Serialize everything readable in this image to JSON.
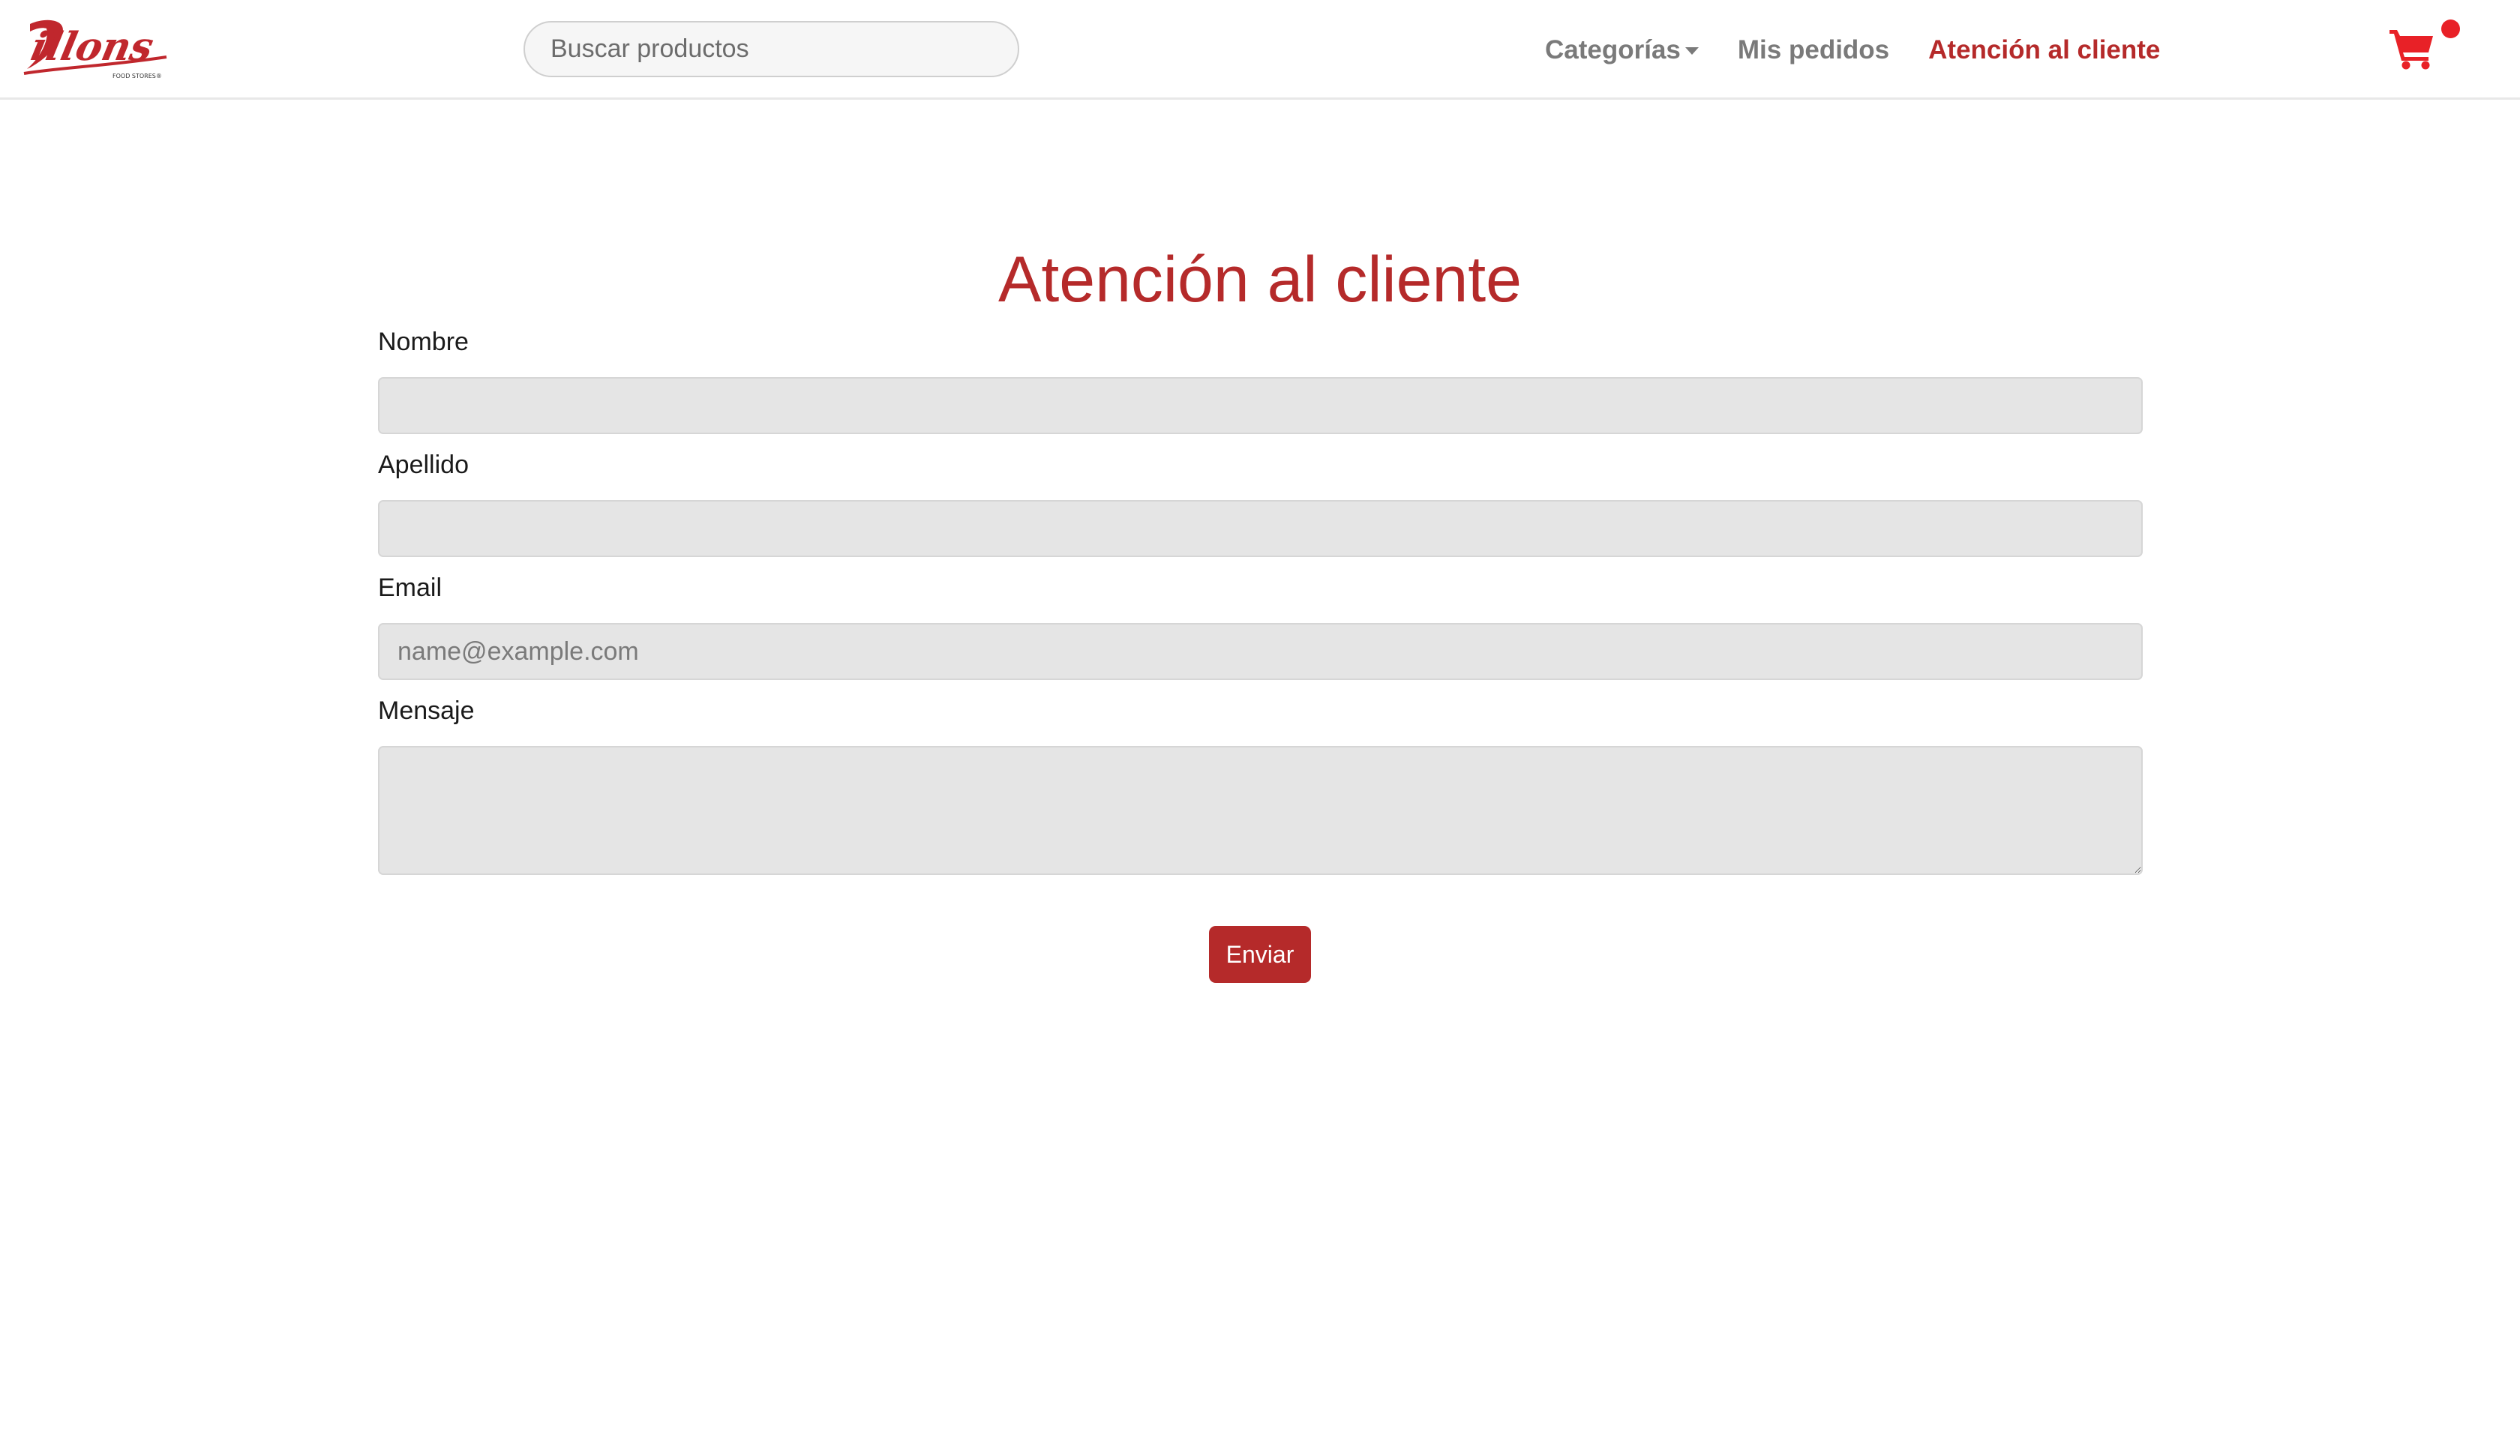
{
  "brand": {
    "logo_text": "Dillons",
    "logo_subtext": "FOOD STORES®",
    "accent_color": "#b52a2a"
  },
  "header": {
    "search": {
      "placeholder": "Buscar productos",
      "value": ""
    },
    "nav": {
      "categories_label": "Categorías",
      "orders_label": "Mis pedidos",
      "support_label": "Atención al cliente"
    },
    "cart_icon": "shopping-cart-icon"
  },
  "form": {
    "title": "Atención al cliente",
    "first_name": {
      "label": "Nombre",
      "value": "",
      "placeholder": ""
    },
    "last_name": {
      "label": "Apellido",
      "value": "",
      "placeholder": ""
    },
    "email": {
      "label": "Email",
      "value": "",
      "placeholder": "name@example.com"
    },
    "message": {
      "label": "Mensaje",
      "value": "",
      "placeholder": ""
    },
    "submit_label": "Enviar"
  }
}
